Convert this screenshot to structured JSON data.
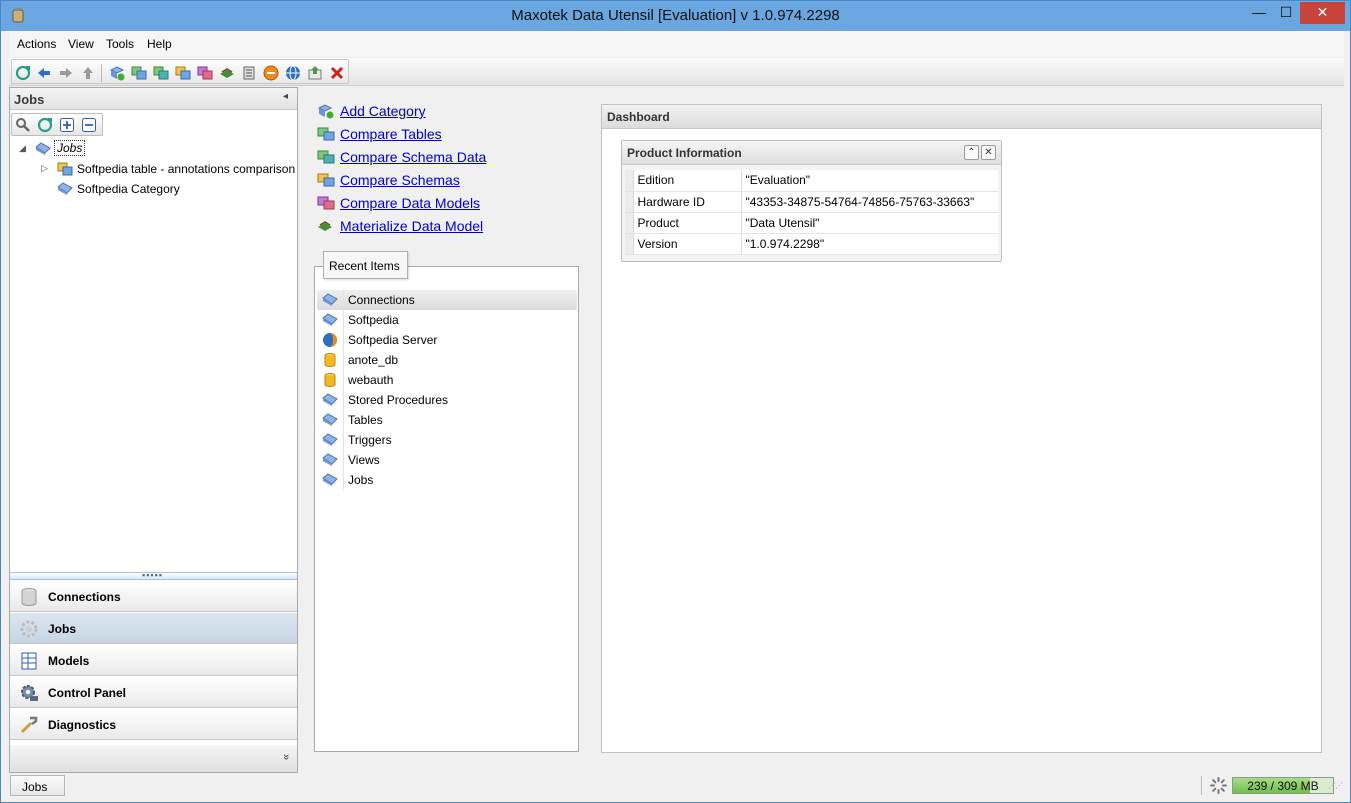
{
  "window": {
    "title": "Maxotek Data Utensil [Evaluation] v 1.0.974.2298",
    "minimize": "—",
    "maximize": "☐",
    "close": "✕"
  },
  "menu": {
    "items": [
      "Actions",
      "View",
      "Tools",
      "Help"
    ]
  },
  "toolbar": {
    "icons": [
      "refresh-icon",
      "back-icon",
      "forward-icon",
      "up-icon",
      "add-category-icon",
      "compare-tables-icon",
      "compare-schema-data-icon",
      "compare-schemas-icon",
      "compare-data-models-icon",
      "materialize-icon",
      "list-icon",
      "stop-icon",
      "web-icon",
      "export-icon",
      "delete-icon"
    ]
  },
  "left_panel": {
    "title": "Jobs",
    "collapse_glyph": "◂",
    "tools": [
      "search-icon",
      "refresh-icon",
      "expand-all-icon",
      "collapse-all-icon"
    ],
    "tree": [
      {
        "label": "Jobs",
        "level": 0,
        "expanded": true,
        "selected": true
      },
      {
        "label": "Softpedia table - annotations comparison",
        "level": 1,
        "expanded": false
      },
      {
        "label": "Softpedia Category",
        "level": 1
      }
    ],
    "splitter_glyph": "▪▪▪▪▪",
    "nav": [
      {
        "label": "Connections",
        "icon": "database-icon",
        "active": false
      },
      {
        "label": "Jobs",
        "icon": "gear-icon",
        "active": true
      },
      {
        "label": "Models",
        "icon": "models-icon",
        "active": false
      },
      {
        "label": "Control Panel",
        "icon": "control-panel-icon",
        "active": false
      },
      {
        "label": "Diagnostics",
        "icon": "wrench-icon",
        "active": false
      }
    ],
    "more_glyph": "»"
  },
  "quick_links": [
    {
      "label": "Add Category",
      "icon": "add-category-icon"
    },
    {
      "label": "Compare Tables",
      "icon": "compare-tables-icon"
    },
    {
      "label": "Compare Schema Data",
      "icon": "compare-schema-data-icon"
    },
    {
      "label": "Compare Schemas",
      "icon": "compare-schemas-icon"
    },
    {
      "label": "Compare Data Models",
      "icon": "compare-data-models-icon"
    },
    {
      "label": "Materialize Data Model",
      "icon": "materialize-icon"
    }
  ],
  "recent": {
    "tab_label": "Recent Items",
    "items": [
      {
        "label": "Connections",
        "icon": "folder-icon",
        "selected": true
      },
      {
        "label": "Softpedia",
        "icon": "folder-icon"
      },
      {
        "label": "Softpedia Server",
        "icon": "server-icon"
      },
      {
        "label": "anote_db",
        "icon": "database-icon"
      },
      {
        "label": "webauth",
        "icon": "database-icon"
      },
      {
        "label": "Stored Procedures",
        "icon": "folder-icon"
      },
      {
        "label": "Tables",
        "icon": "folder-icon"
      },
      {
        "label": "Triggers",
        "icon": "folder-icon"
      },
      {
        "label": "Views",
        "icon": "folder-icon"
      },
      {
        "label": "Jobs",
        "icon": "folder-icon"
      }
    ]
  },
  "dashboard": {
    "title": "Dashboard",
    "product_info": {
      "title": "Product Information",
      "collapse_glyph": "⌃",
      "close_glyph": "✕",
      "rows": [
        {
          "key": "Edition",
          "value": "\"Evaluation\""
        },
        {
          "key": "Hardware ID",
          "value": "\"43353-34875-54764-74856-75763-33663\""
        },
        {
          "key": "Product",
          "value": "\"Data Utensil\""
        },
        {
          "key": "Version",
          "value": "\"1.0.974.2298\""
        }
      ]
    }
  },
  "status": {
    "tab_label": "Jobs",
    "memory_text": "239 / 309 MB",
    "memory_fraction": 0.773
  },
  "colors": {
    "titlebar": "#6aa6e0",
    "link": "#0000cc",
    "close": "#c7443a",
    "memory": "#6fbf4a"
  }
}
